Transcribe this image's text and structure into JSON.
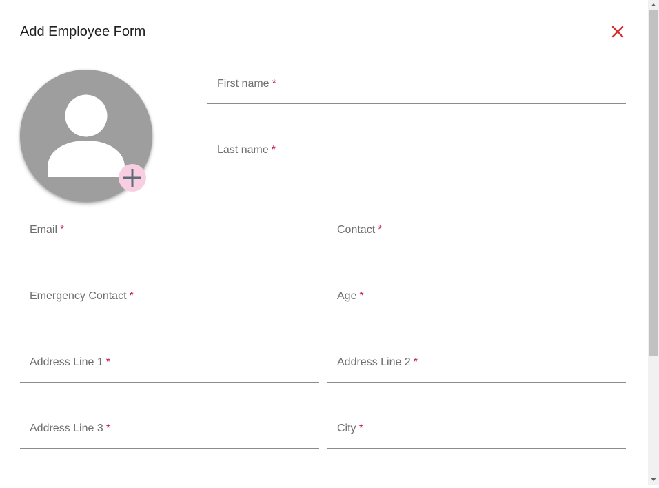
{
  "dialog": {
    "title": "Add Employee Form",
    "close_icon": "close-icon",
    "close_color": "#d32f2f"
  },
  "avatar": {
    "icon": "person-icon",
    "background": "#9e9e9e",
    "add_icon": "plus-icon",
    "add_background": "#f8cfe0"
  },
  "fields": {
    "first_name": {
      "label": "First name",
      "required_mark": "*",
      "value": ""
    },
    "last_name": {
      "label": "Last name",
      "required_mark": "*",
      "value": ""
    },
    "email": {
      "label": "Email",
      "required_mark": "*",
      "value": ""
    },
    "contact": {
      "label": "Contact",
      "required_mark": "*",
      "value": ""
    },
    "emergency_contact": {
      "label": "Emergency Contact",
      "required_mark": "*",
      "value": ""
    },
    "age": {
      "label": "Age",
      "required_mark": "*",
      "value": ""
    },
    "address_line_1": {
      "label": "Address Line 1",
      "required_mark": "*",
      "value": ""
    },
    "address_line_2": {
      "label": "Address Line 2",
      "required_mark": "*",
      "value": ""
    },
    "address_line_3": {
      "label": "Address Line 3",
      "required_mark": "*",
      "value": ""
    },
    "city": {
      "label": "City",
      "required_mark": "*",
      "value": ""
    }
  },
  "colors": {
    "required": "#c2185b",
    "underline": "#8c8c8c",
    "label": "#6f6f6f"
  }
}
